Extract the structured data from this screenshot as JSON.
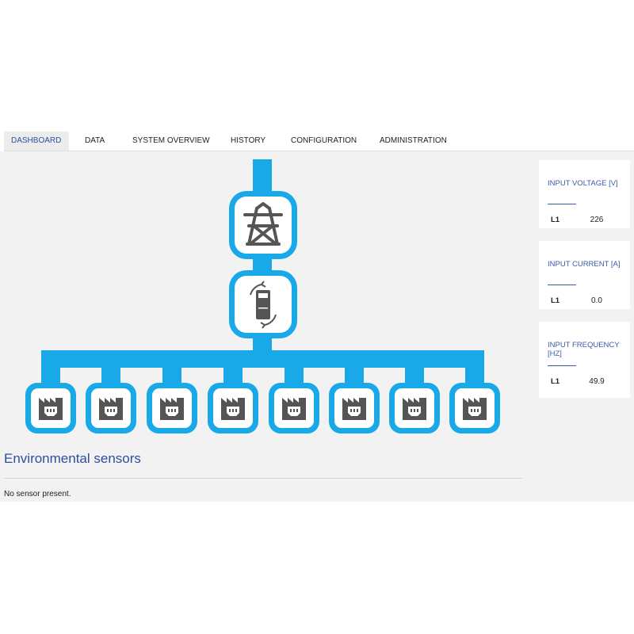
{
  "tabs": [
    {
      "label": "DASHBOARD",
      "active": true
    },
    {
      "label": "DATA"
    },
    {
      "label": "SYSTEM OVERVIEW"
    },
    {
      "label": "HISTORY"
    },
    {
      "label": "CONFIGURATION"
    },
    {
      "label": "ADMINISTRATION"
    }
  ],
  "diagram": {
    "source_icon": "power-tower-icon",
    "device_icon": "ups-device-icon",
    "outlet_icon": "outlet-icon",
    "outlet_count": 8,
    "line_color": "#19a9e9",
    "icon_color": "#555555"
  },
  "environment": {
    "title": "Environmental sensors",
    "message": "No sensor present."
  },
  "cards": [
    {
      "title": "INPUT VOLTAGE [V]",
      "phase": "L1",
      "value": "226"
    },
    {
      "title": "INPUT CURRENT [A]",
      "phase": "L1",
      "value": "0.0"
    },
    {
      "title": "INPUT FREQUENCY [HZ]",
      "phase": "L1",
      "value": "49.9"
    }
  ]
}
